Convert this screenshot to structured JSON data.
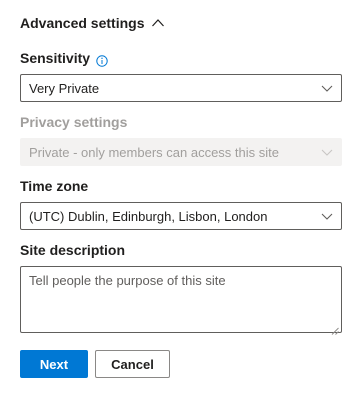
{
  "section": {
    "title": "Advanced settings",
    "expanded_icon": "chevron-up-icon"
  },
  "sensitivity": {
    "label": "Sensitivity",
    "info_icon": "info-icon",
    "value": "Very Private"
  },
  "privacy": {
    "label": "Privacy settings",
    "value": "Private - only members can access this site",
    "disabled": true
  },
  "timezone": {
    "label": "Time zone",
    "value": "(UTC) Dublin, Edinburgh, Lisbon, London"
  },
  "description": {
    "label": "Site description",
    "placeholder": "Tell people the purpose of this site",
    "value": ""
  },
  "buttons": {
    "next": "Next",
    "cancel": "Cancel"
  },
  "colors": {
    "primary": "#0078d4",
    "text": "#201f1e",
    "disabled_text": "#a19f9d",
    "disabled_bg": "#f3f2f1",
    "border": "#605e5c"
  }
}
